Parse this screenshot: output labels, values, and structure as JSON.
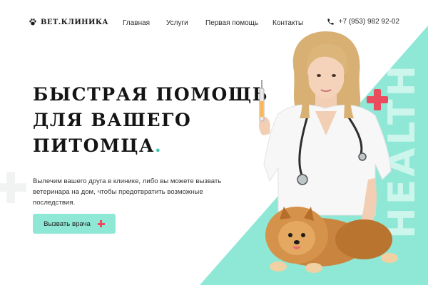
{
  "header": {
    "logo_text": "ВЕТ.КЛИНИКА",
    "logo_icon": "paw-icon",
    "nav": [
      {
        "label": "Главная"
      },
      {
        "label": "Услуги"
      },
      {
        "label": "Первая помощь"
      },
      {
        "label": "Контакты"
      }
    ],
    "phone_icon": "phone-icon",
    "phone": "+7 (953) 982 92-02"
  },
  "hero": {
    "title_lines": [
      "БЫСТРАЯ ПОМОЩЬ",
      "ДЛЯ ВАШЕГО",
      "ПИТОМЦА"
    ],
    "title_dot": ".",
    "description": "Вылечим вашего друга в клинике, либо вы можете вызвать ветеринара на дом, чтобы предотвратить возможные последствия.",
    "cta_label": "Вызвать врача",
    "cta_icon": "plus-icon"
  },
  "visual": {
    "background_word": "HEALTH",
    "accent_color": "#8fe8d6",
    "plus_color": "#ea4c5e",
    "photo_subject": "veterinarian-with-pomeranian-photo"
  },
  "colors": {
    "accent": "#3cc9b0",
    "mint": "#8fe8d6",
    "red": "#ea4c5e",
    "text": "#141414"
  }
}
